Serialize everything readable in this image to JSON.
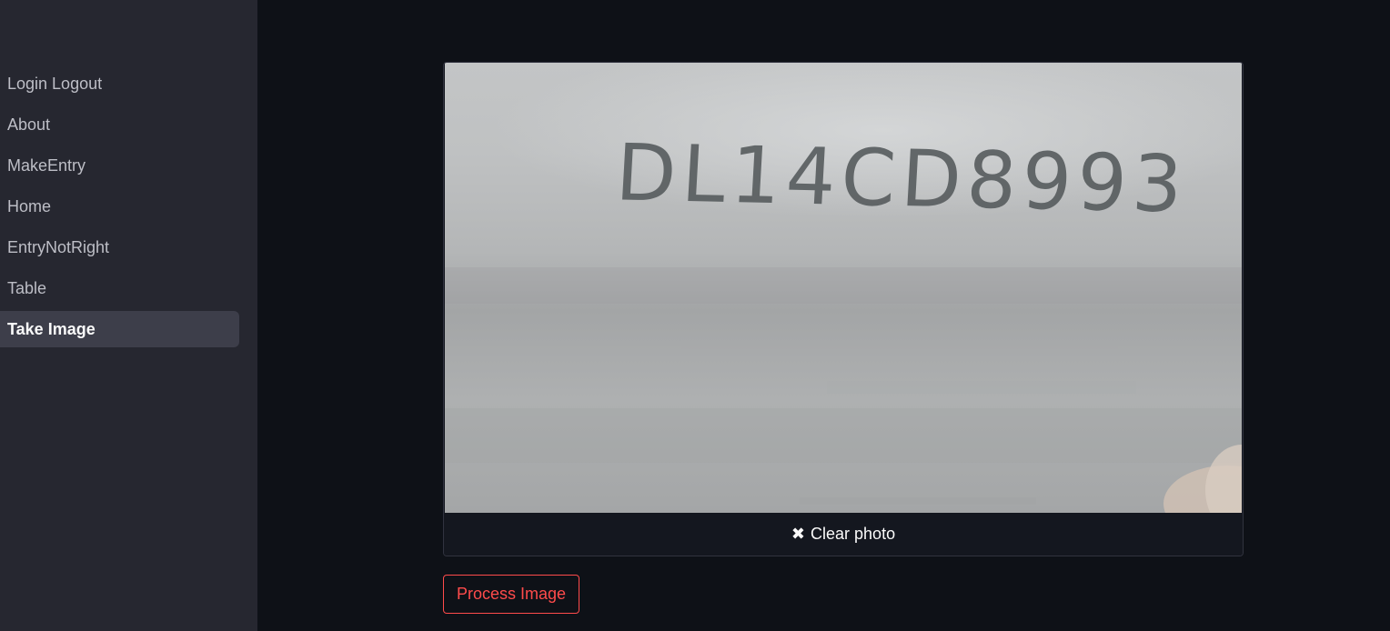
{
  "sidebar": {
    "items": [
      {
        "label": "Login Logout",
        "active": false
      },
      {
        "label": "About",
        "active": false
      },
      {
        "label": "MakeEntry",
        "active": false
      },
      {
        "label": "Home",
        "active": false
      },
      {
        "label": "EntryNotRight",
        "active": false
      },
      {
        "label": "Table",
        "active": false
      },
      {
        "label": "Take Image",
        "active": true
      }
    ]
  },
  "camera": {
    "photo_text": "DL14CD8993",
    "clear_icon": "close-icon",
    "clear_label": "Clear photo"
  },
  "actions": {
    "process_label": "Process Image"
  },
  "colors": {
    "background": "#0e1117",
    "sidebar": "#262730",
    "active_item": "#3d3e4a",
    "accent": "#ff4b4b"
  }
}
